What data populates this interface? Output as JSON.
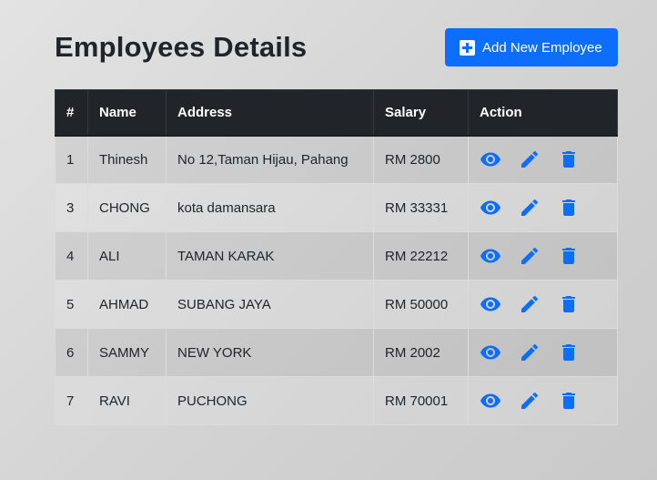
{
  "page": {
    "title": "Employees Details",
    "add_button_label": "Add New Employee"
  },
  "colors": {
    "accent": "#0d6efd",
    "header_bg": "#212529"
  },
  "icons": {
    "add": "plus-square-icon",
    "view": "eye-icon",
    "edit": "pencil-icon",
    "delete": "trash-icon"
  },
  "table": {
    "headers": [
      "#",
      "Name",
      "Address",
      "Salary",
      "Action"
    ],
    "rows": [
      {
        "id": "1",
        "name": "Thinesh",
        "address": "No 12,Taman Hijau, Pahang",
        "salary": "RM 2800"
      },
      {
        "id": "3",
        "name": "CHONG",
        "address": "kota damansara",
        "salary": "RM 33331"
      },
      {
        "id": "4",
        "name": "ALI",
        "address": "TAMAN KARAK",
        "salary": "RM 22212"
      },
      {
        "id": "5",
        "name": "AHMAD",
        "address": "SUBANG JAYA",
        "salary": "RM 50000"
      },
      {
        "id": "6",
        "name": "SAMMY",
        "address": "NEW YORK",
        "salary": "RM 2002"
      },
      {
        "id": "7",
        "name": "RAVI",
        "address": "PUCHONG",
        "salary": "RM 70001"
      }
    ]
  }
}
